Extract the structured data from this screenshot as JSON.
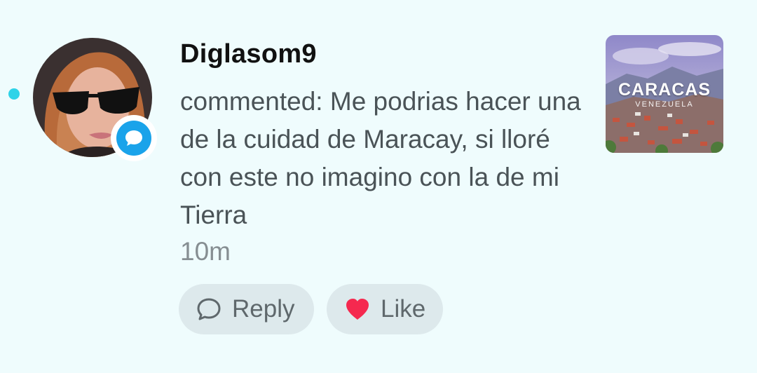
{
  "notification": {
    "unread": true,
    "avatar_icon": "user-photo",
    "badge_icon": "comment-bubble-icon",
    "username": "Diglasom9",
    "comment_prefix": "commented:",
    "comment_text": "Me podrias hacer una de la cuidad de Maracay, si lloré con este no imagino con la de mi Tierra",
    "time": "10m",
    "thumbnail": {
      "title": "CARACAS",
      "subtitle": "VENEZUELA"
    },
    "actions": {
      "reply_label": "Reply",
      "like_label": "Like"
    }
  },
  "colors": {
    "background": "#effcfd",
    "unread_dot": "#2fd3e8",
    "badge": "#1aa3ea",
    "like_heart": "#f5294f",
    "pill_bg": "#dde9ec"
  }
}
